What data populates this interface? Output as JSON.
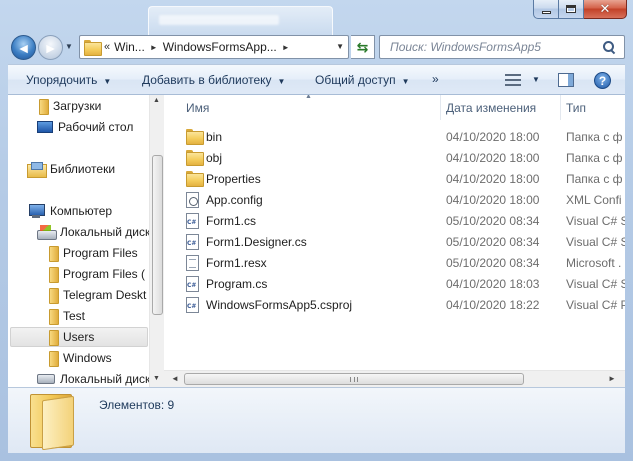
{
  "window": {
    "address": {
      "overflow_marker": "«",
      "crumbs": [
        "Win...",
        "WindowsFormsApp..."
      ]
    },
    "search": {
      "placeholder": "Поиск: WindowsFormsApp5"
    }
  },
  "commands": {
    "organize": "Упорядочить",
    "add_to_library": "Добавить в библиотеку",
    "share": "Общий доступ",
    "more": "»"
  },
  "nav_pane": {
    "items": [
      {
        "label": "Загрузки",
        "icon": "downloads-folder-icon"
      },
      {
        "label": "Рабочий стол",
        "icon": "desktop-icon"
      },
      {
        "label": "Библиотеки",
        "icon": "libraries-icon"
      },
      {
        "label": "Компьютер",
        "icon": "computer-icon"
      },
      {
        "label": "Локальный диск",
        "icon": "drive-icon"
      },
      {
        "label": "Program Files",
        "icon": "folder-icon"
      },
      {
        "label": "Program Files (",
        "icon": "folder-icon"
      },
      {
        "label": "Telegram Deskt",
        "icon": "folder-icon"
      },
      {
        "label": "Test",
        "icon": "folder-icon"
      },
      {
        "label": "Users",
        "icon": "folder-icon",
        "selected": true
      },
      {
        "label": "Windows",
        "icon": "folder-icon"
      },
      {
        "label": "Локальный диск",
        "icon": "drive-icon"
      }
    ]
  },
  "columns": {
    "name": "Имя",
    "date": "Дата изменения",
    "type": "Тип"
  },
  "files": [
    {
      "name": "bin",
      "date": "04/10/2020 18:00",
      "type": "Папка с ф",
      "icon": "folder"
    },
    {
      "name": "obj",
      "date": "04/10/2020 18:00",
      "type": "Папка с ф",
      "icon": "folder"
    },
    {
      "name": "Properties",
      "date": "04/10/2020 18:00",
      "type": "Папка с ф",
      "icon": "folder"
    },
    {
      "name": "App.config",
      "date": "04/10/2020 18:00",
      "type": "XML Confi",
      "icon": "config"
    },
    {
      "name": "Form1.cs",
      "date": "05/10/2020 08:34",
      "type": "Visual C# S",
      "icon": "cs"
    },
    {
      "name": "Form1.Designer.cs",
      "date": "05/10/2020 08:34",
      "type": "Visual C# S",
      "icon": "cs"
    },
    {
      "name": "Form1.resx",
      "date": "05/10/2020 08:34",
      "type": "Microsoft .",
      "icon": "doc"
    },
    {
      "name": "Program.cs",
      "date": "04/10/2020 18:03",
      "type": "Visual C# S",
      "icon": "cs"
    },
    {
      "name": "WindowsFormsApp5.csproj",
      "date": "04/10/2020 18:22",
      "type": "Visual C# P",
      "icon": "cs"
    }
  ],
  "details": {
    "item_count": "Элементов: 9"
  }
}
